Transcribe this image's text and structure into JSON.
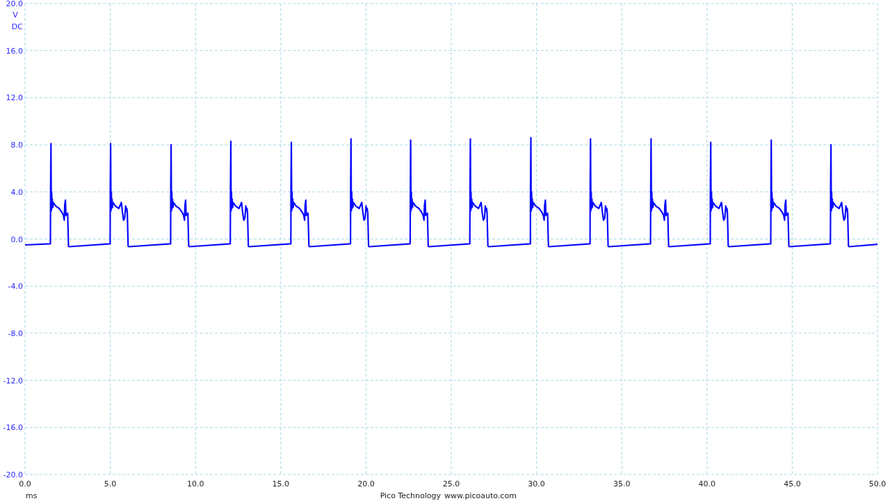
{
  "chart": {
    "y_axis": {
      "unit": "V",
      "coupling": "DC",
      "ticks": [
        "20.0",
        "16.0",
        "12.0",
        "8.0",
        "4.0",
        "0.0",
        "-4.0",
        "-8.0",
        "-12.0",
        "-16.0",
        "-20.0"
      ]
    },
    "x_axis": {
      "unit": "ms",
      "ticks": [
        "0.0",
        "5.0",
        "10.0",
        "15.0",
        "20.0",
        "25.0",
        "30.0",
        "35.0",
        "40.0",
        "45.0",
        "50.0"
      ]
    }
  },
  "footer": {
    "company": "Pico Technology",
    "website": "www.picoauto.com"
  }
}
